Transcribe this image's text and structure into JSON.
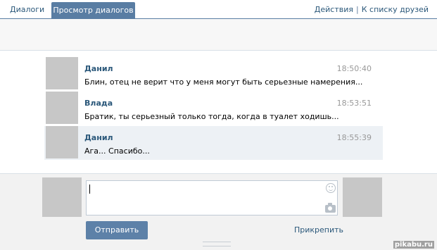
{
  "tabs": [
    {
      "label": "Диалоги",
      "active": false
    },
    {
      "label": "Просмотр диалогов",
      "active": true
    }
  ],
  "toplinks": {
    "actions": "Действия",
    "separator": "|",
    "friends": "К списку друзей"
  },
  "messages": [
    {
      "author": "Данил",
      "time": "18:50:40",
      "text": "Блин, отец не верит что у меня могут быть серьезные намерения...",
      "highlighted": false
    },
    {
      "author": "Влада",
      "time": "18:53:51",
      "text": "Братик, ты серьезный только тогда, когда в туалет ходишь...",
      "highlighted": false
    },
    {
      "author": "Данил",
      "time": "18:55:39",
      "text": "Ага... Спасибо...",
      "highlighted": true
    }
  ],
  "composer": {
    "value": "",
    "send_label": "Отправить",
    "attach_label": "Прикрепить"
  },
  "icons": {
    "smile": "smile-icon",
    "camera": "camera-icon"
  },
  "watermark": "pikabu.ru",
  "colors": {
    "accent": "#597da3",
    "link": "#2b587a",
    "highlight": "#edf1f5",
    "button": "#5d81a8"
  }
}
